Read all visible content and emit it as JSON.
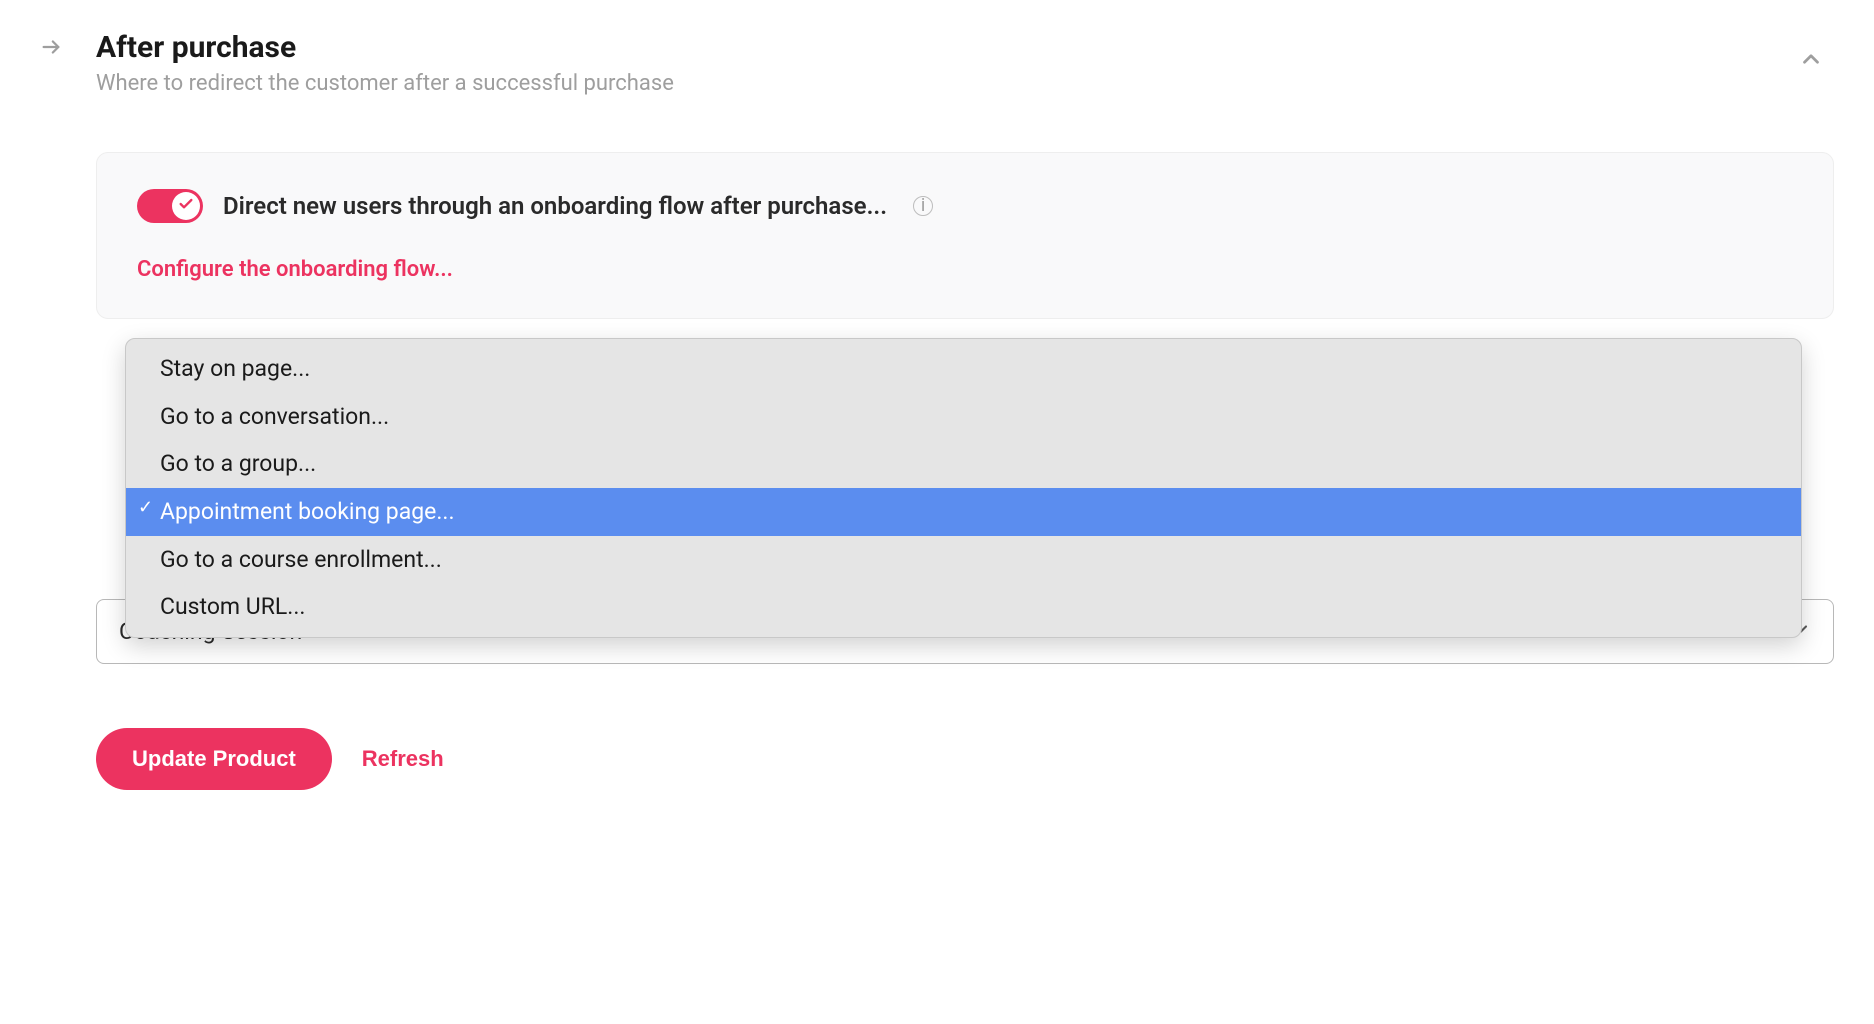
{
  "section": {
    "title": "After purchase",
    "subtitle": "Where to redirect the customer after a successful purchase"
  },
  "toggle": {
    "label": "Direct new users through an onboarding flow after purchase...",
    "enabled": true
  },
  "configure_link": "Configure the onboarding flow...",
  "redirect_options": [
    {
      "label": "Stay on page...",
      "selected": false
    },
    {
      "label": "Go to a conversation...",
      "selected": false
    },
    {
      "label": "Go to a group...",
      "selected": false
    },
    {
      "label": "Appointment booking page...",
      "selected": true
    },
    {
      "label": "Go to a course enrollment...",
      "selected": false
    },
    {
      "label": "Custom URL...",
      "selected": false
    }
  ],
  "secondary_select": {
    "value": "Coaching Session"
  },
  "actions": {
    "primary": "Update Product",
    "refresh": "Refresh"
  }
}
